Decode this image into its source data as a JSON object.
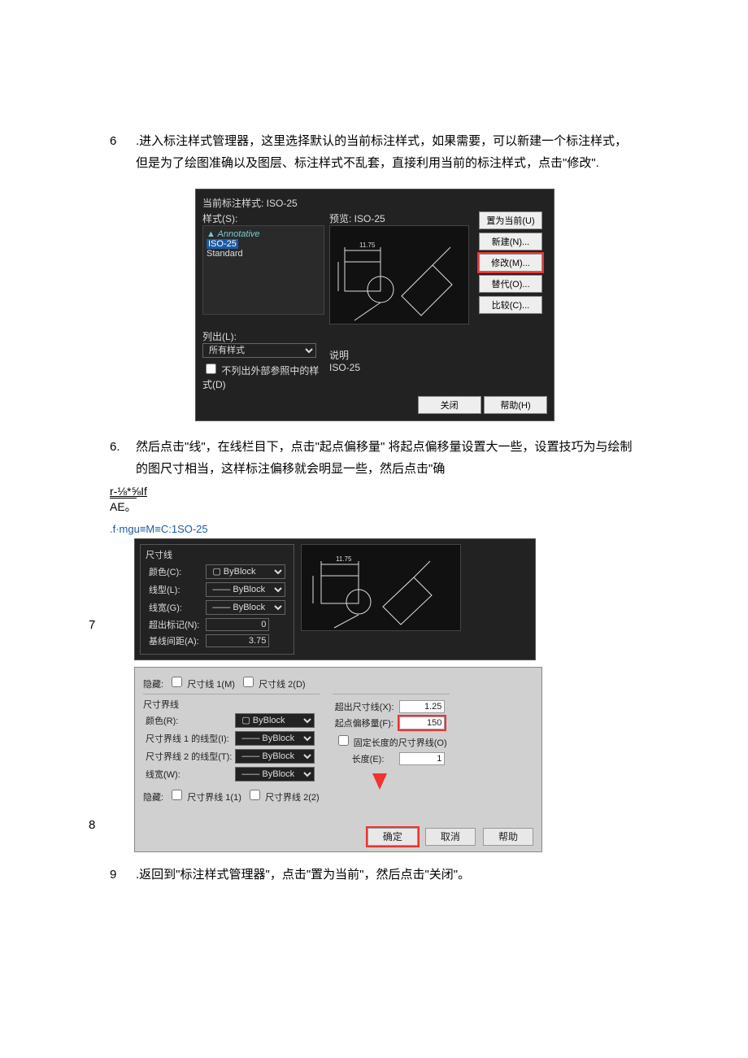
{
  "steps": {
    "s6_num": "6",
    "s6_text": ".进入标注样式管理器，这里选择默认的当前标注样式，如果需要，可以新建一个标注样式，但是为了绘图准确以及图层、标注样式不乱套，直接利用当前的标注样式，点击\"修改\".",
    "s6b_num": "6.",
    "s6b_text": "然后点击\"线\"，在线栏目下，点击\"起点偏移量\" 将起点偏移量设置大一些，设置技巧为与绘制的图尺寸相当，这样标注偏移就会明显一些，然后点击\"确",
    "frag1": "r-⅛*⅝If",
    "frag2": "AE。",
    "blue_note": ".f·mgu≡M≡C:1SO-25",
    "n7": "7",
    "n8": "8",
    "s9_num": "9",
    "s9_text": ".返回到\"标注样式管理器\"，点击\"置为当前\"，然后点击\"关闭\"。"
  },
  "dlg1": {
    "cur_label": "当前标注样式: ISO-25",
    "styles_label": "样式(S):",
    "preview_label": "预览: ISO-25",
    "list_ann": "Annotative",
    "list_sel": "ISO-25",
    "list_std": "Standard",
    "list_out": "列出(L):",
    "list_all": "所有样式",
    "chk_ext": "不列出外部参照中的样式(D)",
    "desc_label": "说明",
    "desc_val": "ISO-25",
    "btn_set": "置为当前(U)",
    "btn_new": "新建(N)...",
    "btn_mod": "修改(M)...",
    "btn_ovr": "替代(O)...",
    "btn_cmp": "比较(C)...",
    "btn_close": "关闭",
    "btn_help": "帮助(H)",
    "sample": "11.75"
  },
  "dlg2": {
    "grp": "尺寸线",
    "color": "颜色(C):",
    "ltype": "线型(L):",
    "lwt": "线宽(G):",
    "ext_tick": "超出标记(N):",
    "baseline": "基线间距(A):",
    "byblock": "ByBlock",
    "ext_tick_v": "0",
    "baseline_v": "3.75",
    "sample": "11.75",
    "hide": "隐藏:",
    "dim1": "尺寸线 1(M)",
    "dim2": "尺寸线 2(D)"
  },
  "dlg3": {
    "grp": "尺寸界线",
    "color": "颜色(R):",
    "elt1": "尺寸界线 1 的线型(I):",
    "elt2": "尺寸界线 2 的线型(T):",
    "lwt": "线宽(W):",
    "byblock": "ByBlock",
    "hide": "隐藏:",
    "e1": "尺寸界线 1(1)",
    "e2": "尺寸界线 2(2)",
    "exbey": "超出尺寸线(X):",
    "exbey_v": "1.25",
    "orig": "起点偏移量(F):",
    "orig_v": "150",
    "fix": "固定长度的尺寸界线(O)",
    "len": "长度(E):",
    "len_v": "1",
    "ok": "确定",
    "cancel": "取消",
    "help": "帮助"
  }
}
